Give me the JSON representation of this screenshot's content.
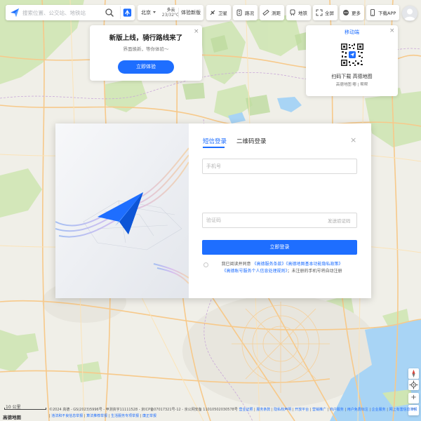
{
  "search": {
    "placeholder": "搜索位置、公交站、地铁站"
  },
  "city": {
    "name": "北京"
  },
  "weather": {
    "condition": "多云",
    "temperature": "23/32°C"
  },
  "traffic_label": "体验新版",
  "toolbar": [
    {
      "label": "卫星",
      "icon": "satellite-icon"
    },
    {
      "label": "路况",
      "icon": "traffic-icon"
    },
    {
      "label": "测距",
      "icon": "ruler-icon"
    },
    {
      "label": "地铁",
      "icon": "subway-icon"
    },
    {
      "label": "全屏",
      "icon": "fullscreen-icon"
    },
    {
      "label": "更多",
      "icon": "more-icon"
    },
    {
      "label": "下载APP",
      "icon": "phone-icon"
    }
  ],
  "promo": {
    "title": "新版上线，骑行路线来了",
    "subtitle": "界面焕新，等你体验～",
    "button": "立即体验",
    "close": "×"
  },
  "mobile_panel": {
    "title": "移动端",
    "caption": "扫码下载 高德地图",
    "subcaption": "高德地图 嘟 | 帮帮",
    "close": "×"
  },
  "login": {
    "tab_sms": "短信登录",
    "tab_qr": "二维码登录",
    "phone_placeholder": "手机号",
    "code_placeholder": "验证码",
    "send_code": "发送验证码",
    "submit": "立即登录",
    "agree_prefix": "我已阅读并同意",
    "agree_link1": "《高德服务条款》",
    "agree_link2": "《高德地图基本功能隐私政策》",
    "agree_link3": "《高德账号服务个人信息处理规则》",
    "agree_suffix": "；未注册的手机号将自动注册",
    "close": "×"
  },
  "map_controls": {
    "zoom_in": "+",
    "zoom_out": "−"
  },
  "map_labels": [],
  "footer": {
    "scale_label": "10 公里",
    "copyright": "©2024 高德 - GS(2023)5996号 - 甲测资字11111528 - 京ICP备07017321号-12 - ",
    "police": "京公网安备 11010502030578号",
    "links": [
      "营业证照",
      "服务条款",
      "隐私权声明",
      "开放平台",
      "营销推广",
      "商户服务",
      "用户免费标注",
      "企业服务",
      "网上有害信息举报",
      "违法和不良信息举报",
      "算法推荐举报",
      "生活服务专项举报",
      "廉正举报"
    ],
    "logo": "高德地图"
  }
}
